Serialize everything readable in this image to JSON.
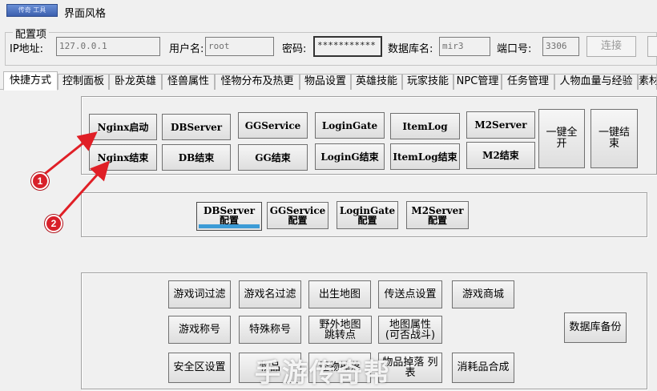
{
  "titlebar": {
    "logo_text": "传奇 工具",
    "menu_label": "界面风格"
  },
  "config": {
    "group_title": "配置项",
    "ip_label": "IP地址:",
    "ip_value": "127.0.0.1",
    "user_label": "用户名:",
    "user_value": "root",
    "pass_label": "密码:",
    "pass_value": "***********",
    "db_label": "数据库名:",
    "db_value": "mir3",
    "port_label": "端口号:",
    "port_value": "3306",
    "connect_label": "连接"
  },
  "tabs": [
    {
      "label": "快捷方式",
      "active": true
    },
    {
      "label": "控制面板"
    },
    {
      "label": "卧龙英雄"
    },
    {
      "label": "怪兽属性"
    },
    {
      "label": "怪物分布及热更"
    },
    {
      "label": "物品设置"
    },
    {
      "label": "英雄技能"
    },
    {
      "label": "玩家技能"
    },
    {
      "label": "NPC管理"
    },
    {
      "label": "任务管理"
    },
    {
      "label": "人物血量与经验"
    },
    {
      "label": "素材"
    }
  ],
  "server_buttons": {
    "nginx_start": "Nginx启动",
    "nginx_stop": "Nginx结束",
    "dbserver": "DBServer",
    "db_stop": "DB结束",
    "ggservice": "GGService",
    "gg_stop": "GG结束",
    "logingate": "LoginGate",
    "loging_stop": "LoginG结束",
    "itemlog": "ItemLog",
    "itemlog_stop": "ItemLog结束",
    "m2server": "M2Server",
    "m2_stop": "M2结束",
    "start_all": "一键全开",
    "stop_all": "一键结束"
  },
  "config_buttons": {
    "dbserver_cfg": "DBServer 配置",
    "ggservice_cfg": "GGService 配置",
    "logingate_cfg": "LoginGate 配置",
    "m2server_cfg": "M2Server 配置"
  },
  "game_buttons": {
    "word_filter": "游戏词过滤",
    "name_filter": "游戏名过滤",
    "spawn_map": "出生地图",
    "teleport": "传送点设置",
    "shop": "游戏商城",
    "title": "游戏称号",
    "special_title": "特殊称号",
    "wild_map": "野外地图 跳转点",
    "map_attr": "地图属性 (可否战斗)",
    "safe_zone": "安全区设置",
    "btn_b": "物品",
    "btn_c": "怪物掉落",
    "btn_d": "物品掉落 列表",
    "consumable": "消耗品合成",
    "db_backup": "数据库备份"
  },
  "annotations": {
    "badge1": "1",
    "badge2": "2",
    "arrow_color": "#e01f26"
  },
  "watermark": "手游传奇帮"
}
